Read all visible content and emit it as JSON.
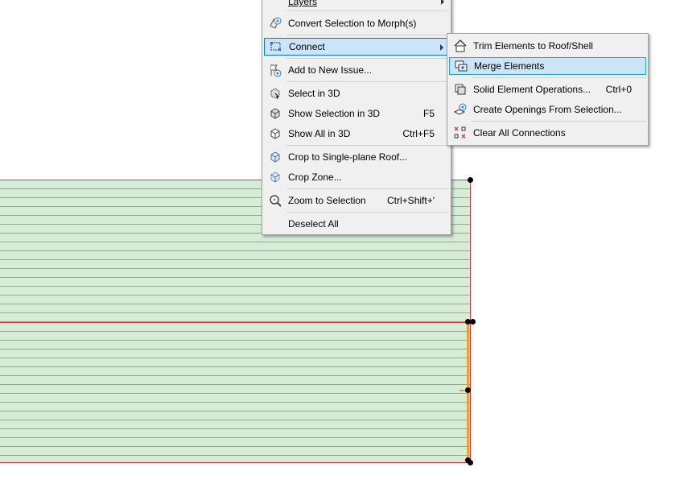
{
  "main_menu": {
    "items": [
      {
        "label": "Layers",
        "has_submenu": true
      },
      {
        "label": "Convert Selection to Morph(s)"
      },
      {
        "label": "Connect",
        "has_submenu": true,
        "highlighted": true
      },
      {
        "label": "Add to New Issue..."
      },
      {
        "label": "Select in 3D"
      },
      {
        "label": "Show Selection in 3D",
        "shortcut": "F5"
      },
      {
        "label": "Show All in 3D",
        "shortcut": "Ctrl+F5"
      },
      {
        "label": "Crop to Single-plane Roof..."
      },
      {
        "label": "Crop Zone..."
      },
      {
        "label": "Zoom to Selection",
        "shortcut": "Ctrl+Shift+'"
      },
      {
        "label": "Deselect All"
      }
    ]
  },
  "sub_menu": {
    "items": [
      {
        "label": "Trim Elements to Roof/Shell"
      },
      {
        "label": "Merge Elements",
        "highlighted": true
      },
      {
        "label": "Solid Element Operations...",
        "shortcut": "Ctrl+0"
      },
      {
        "label": "Create Openings From Selection..."
      },
      {
        "label": "Clear All Connections"
      }
    ]
  },
  "colors": {
    "slab_fill": "#d6ecd6",
    "slab_outline": "#d03a3a",
    "selection_accent": "#f0a030",
    "menu_highlight": "#cce4f7",
    "menu_highlight_border": "#0078d7"
  }
}
